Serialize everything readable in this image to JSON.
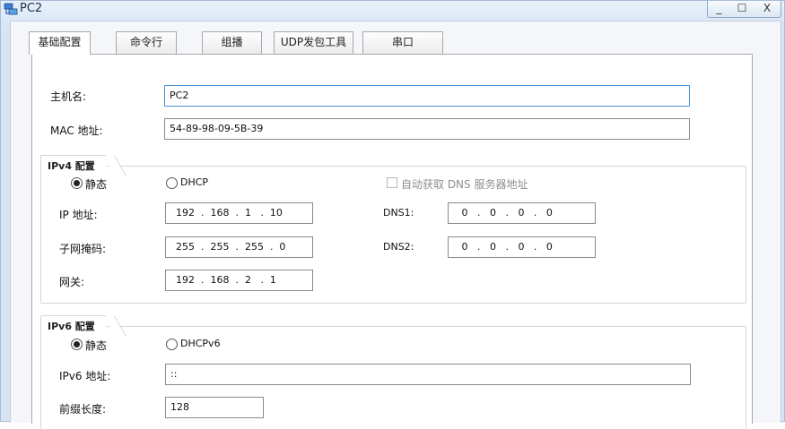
{
  "window": {
    "title": "PC2",
    "app_icon": "pc-network-icon",
    "controls": {
      "minimize": "_",
      "maximize": "☐",
      "close": "X"
    }
  },
  "tabs": [
    {
      "label": "基础配置",
      "active": true
    },
    {
      "label": "命令行",
      "active": false
    },
    {
      "label": "组播",
      "active": false
    },
    {
      "label": "UDP发包工具",
      "active": false
    },
    {
      "label": "串口",
      "active": false
    }
  ],
  "basic": {
    "hostname_label": "主机名:",
    "hostname_value": "PC2",
    "mac_label": "MAC 地址:",
    "mac_value": "54-89-98-09-5B-39"
  },
  "ipv4": {
    "section_title": "IPv4 配置",
    "static_label": "静态",
    "dhcp_label": "DHCP",
    "mode": "static",
    "auto_dns_label": "自动获取 DNS 服务器地址",
    "auto_dns_checked": false,
    "ip_label": "IP 地址:",
    "ip_value": "192  .  168  .  1   .  10",
    "mask_label": "子网掩码:",
    "mask_value": "255  .  255  .  255  .  0",
    "gateway_label": "网关:",
    "gateway_value": "192  .  168  .  2   .  1",
    "dns1_label": "DNS1:",
    "dns1_value": " 0   .   0   .   0   .   0",
    "dns2_label": "DNS2:",
    "dns2_value": " 0   .   0   .   0   .   0"
  },
  "ipv6": {
    "section_title": "IPv6 配置",
    "static_label": "静态",
    "dhcp_label": "DHCPv6",
    "mode": "static",
    "ip_label": "IPv6 地址:",
    "ip_value": "::",
    "prefix_label": "前缀长度:",
    "prefix_value": "128"
  },
  "colors": {
    "titlebar": "#d6e4f5",
    "focus_border": "#4a8fd6",
    "disabled_text": "#8e8e8e"
  }
}
